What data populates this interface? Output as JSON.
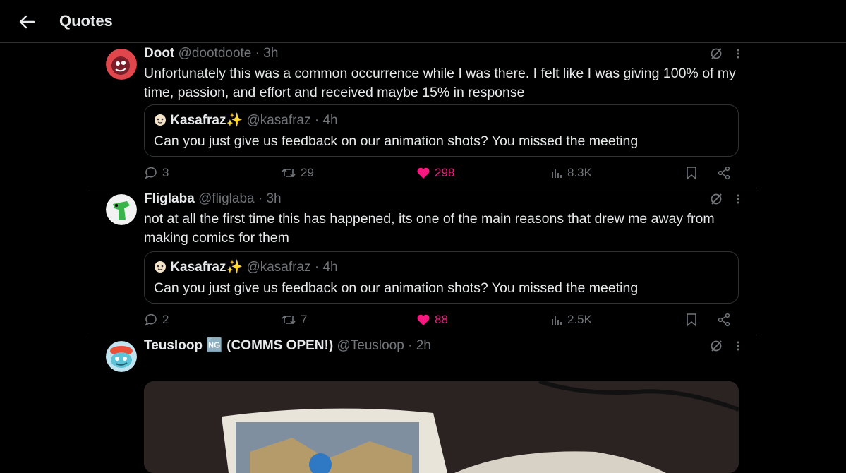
{
  "header": {
    "title": "Quotes"
  },
  "tweets": [
    {
      "name": "Doot",
      "handle": "@dootdoote",
      "time": "3h",
      "text": "Unfortunately this was a common occurrence while I was there. I felt like I was giving 100% of my time, passion, and effort and received maybe 15% in response",
      "quote": {
        "name": "Kasafraz✨",
        "handle": "@kasafraz",
        "time": "4h",
        "text": "Can you just give us feedback on our animation shots? You missed the meeting"
      },
      "stats": {
        "replies": "3",
        "reposts": "29",
        "likes": "298",
        "views": "8.3K"
      }
    },
    {
      "name": "Fliglaba",
      "handle": "@fliglaba",
      "time": "3h",
      "text": "not at all the first time this has happened, its one of the main reasons that drew me away from making comics for them",
      "quote": {
        "name": "Kasafraz✨",
        "handle": "@kasafraz",
        "time": "4h",
        "text": "Can you just give us feedback on our animation shots? You missed the meeting"
      },
      "stats": {
        "replies": "2",
        "reposts": "7",
        "likes": "88",
        "views": "2.5K"
      }
    },
    {
      "name": "Teusloop 🆖 (COMMS OPEN!)",
      "handle": "@Teusloop",
      "time": "2h"
    }
  ],
  "separator": "·",
  "colors": {
    "background": "#000000",
    "text": "#e7e9ea",
    "muted": "#71767b",
    "like": "#f91880",
    "border": "#2f3336"
  }
}
